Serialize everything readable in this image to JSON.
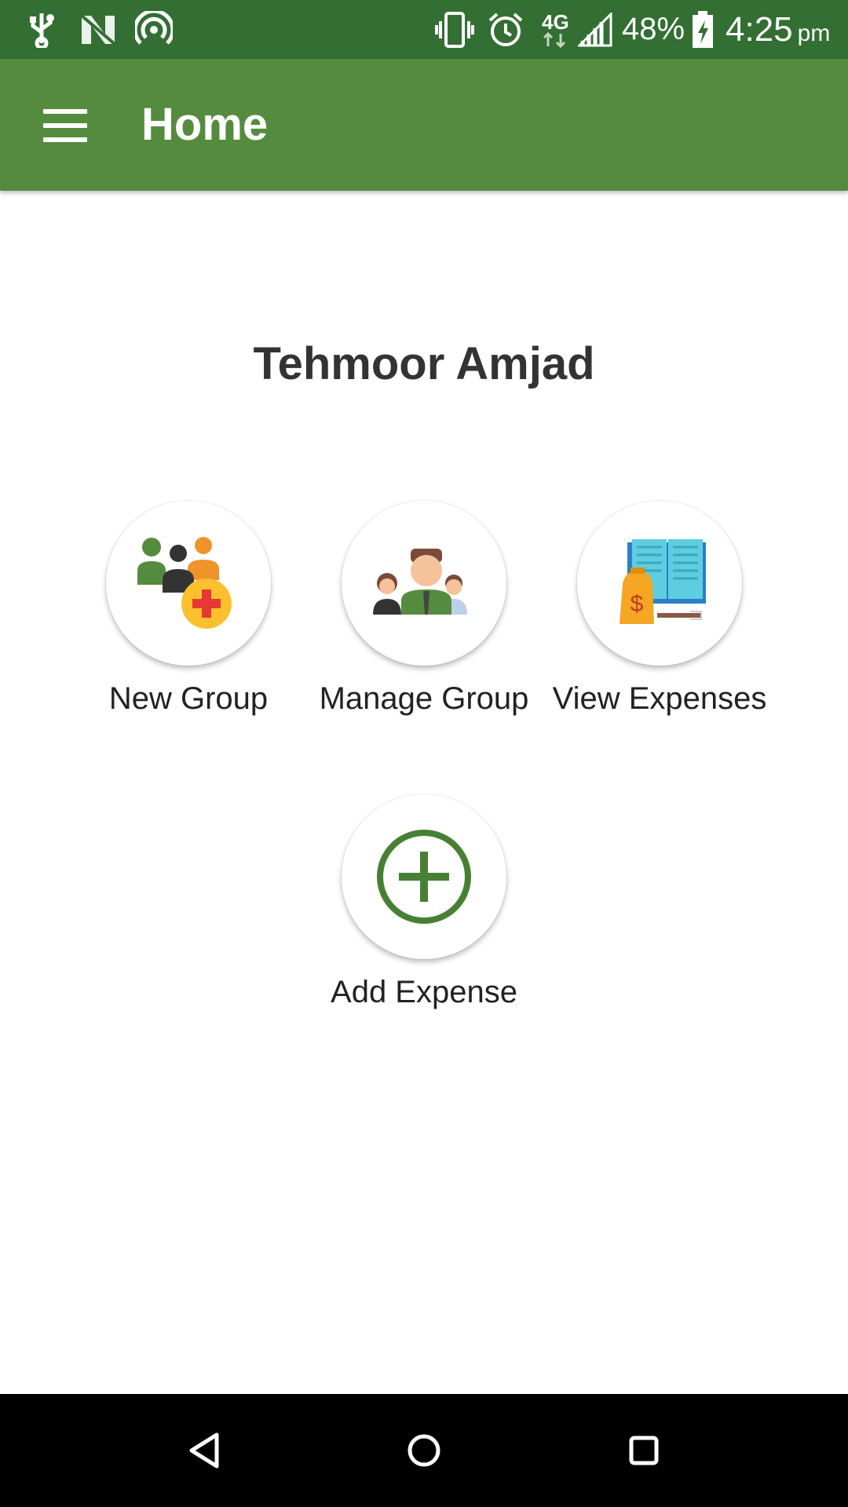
{
  "status_bar": {
    "battery": "48%",
    "network": "4G",
    "time": "4:25",
    "ampm": "pm",
    "background": "#336e32"
  },
  "app_bar": {
    "title": "Home",
    "background": "#558b3e",
    "menu_icon": "hamburger-menu-icon"
  },
  "user": {
    "name": "Tehmoor Amjad"
  },
  "actions": [
    {
      "label": "New Group",
      "icon": "new-group-icon"
    },
    {
      "label": "Manage Group",
      "icon": "manage-group-icon"
    },
    {
      "label": "View Expenses",
      "icon": "view-expenses-icon"
    },
    {
      "label": "Add Expense",
      "icon": "add-expense-icon"
    }
  ],
  "nav_bar": {
    "back_icon": "back-icon",
    "home_icon": "home-icon",
    "recents_icon": "recents-icon"
  }
}
